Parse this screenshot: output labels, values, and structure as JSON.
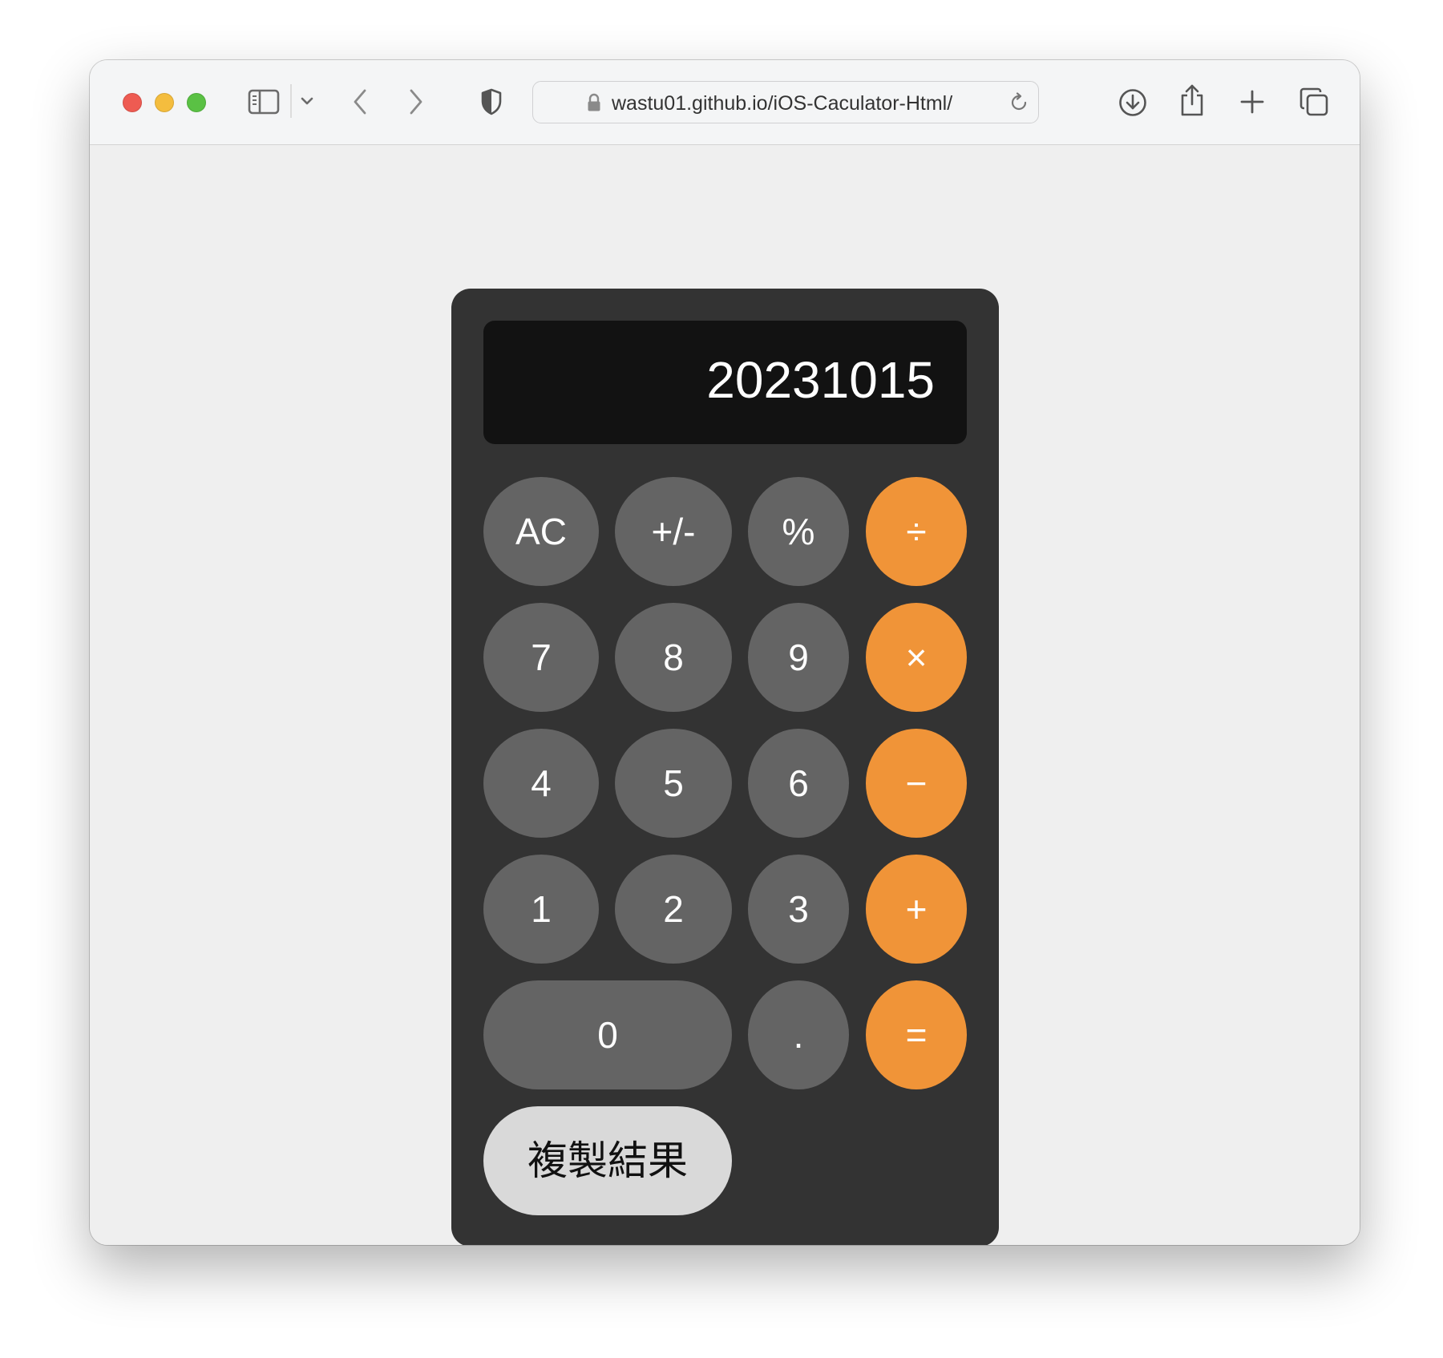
{
  "browser": {
    "url": "wastu01.github.io/iOS-Caculator-Html/",
    "traffic_colors": {
      "close": "#ee5b52",
      "minimize": "#f4bd3e",
      "zoom": "#5ac144"
    },
    "icons": [
      "sidebar-icon",
      "chevron-down-icon",
      "back-icon",
      "forward-icon",
      "privacy-shield-icon",
      "lock-icon",
      "reload-icon",
      "download-icon",
      "share-icon",
      "new-tab-icon",
      "tabs-overview-icon"
    ]
  },
  "calculator": {
    "display_value": "20231015",
    "colors": {
      "body": "#333333",
      "display": "#121212",
      "number_key": "#646464",
      "operator_key": "#f09438",
      "copy_key": "#d9d9d9"
    },
    "keys": {
      "ac": "AC",
      "sign": "+/-",
      "percent": "%",
      "divide": "÷",
      "seven": "7",
      "eight": "8",
      "nine": "9",
      "multiply": "×",
      "four": "4",
      "five": "5",
      "six": "6",
      "subtract": "−",
      "one": "1",
      "two": "2",
      "three": "3",
      "add": "+",
      "zero": "0",
      "decimal": ".",
      "equals": "="
    },
    "copy_label": "複製結果"
  }
}
